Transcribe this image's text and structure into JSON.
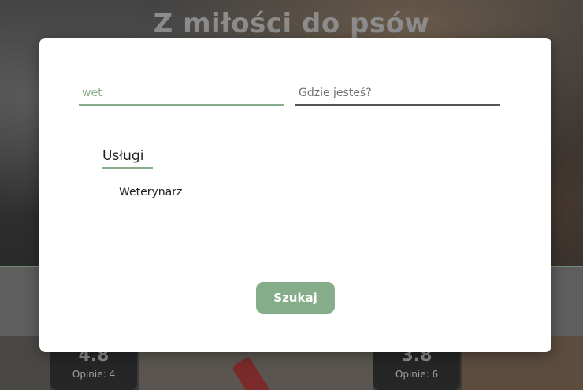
{
  "background": {
    "hero_title": "Z miłości do psów",
    "cards": [
      {
        "rating": "4.8",
        "reviews": "Opinie: 4"
      },
      {
        "rating": "3.8",
        "reviews": "Opinie: 6"
      }
    ]
  },
  "modal": {
    "search": {
      "query_value": "wet",
      "location_placeholder": "Gdzie jesteś?",
      "location_value": ""
    },
    "results": {
      "section_title": "Usługi",
      "items": [
        "Weterynarz"
      ]
    },
    "submit_label": "Szukaj"
  },
  "colors": {
    "accent": "#86ad8a",
    "overlay": "#2b2b2b"
  }
}
